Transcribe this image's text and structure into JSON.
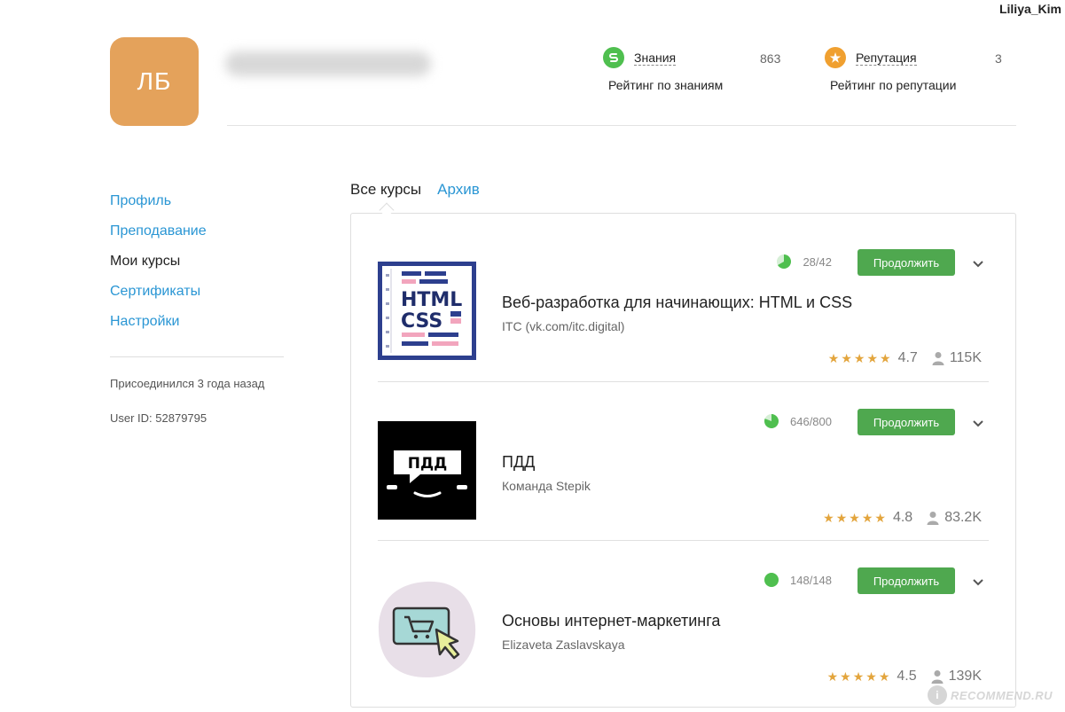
{
  "top_user": "Liliya_Kim",
  "profile": {
    "avatar_initials": "ЛБ",
    "avatar_color": "#e4a25b"
  },
  "stats": {
    "knowledge": {
      "label": "Знания",
      "value": "863",
      "sub": "Рейтинг по знаниям",
      "icon": "knowledge-icon",
      "color": "#4fbf4f"
    },
    "reputation": {
      "label": "Репутация",
      "value": "3",
      "sub": "Рейтинг по репутации",
      "icon": "star-icon",
      "color": "#f0a030"
    }
  },
  "sidebar": {
    "items": [
      {
        "label": "Профиль",
        "active": false
      },
      {
        "label": "Преподавание",
        "active": false
      },
      {
        "label": "Мои курсы",
        "active": true
      },
      {
        "label": "Сертификаты",
        "active": false
      },
      {
        "label": "Настройки",
        "active": false
      }
    ],
    "joined": "Присоединился 3 года назад",
    "user_id": "User ID: 52879795"
  },
  "tabs": [
    {
      "label": "Все курсы",
      "active": true
    },
    {
      "label": "Архив",
      "active": false
    }
  ],
  "courses": [
    {
      "title": "Веб-разработка для начинающих: HTML и CSS",
      "author": "ITC (vk.com/itc.digital)",
      "progress_text": "28/42",
      "progress": 0.667,
      "button": "Продолжить",
      "stars": "★★★★★",
      "rating": "4.7",
      "learners": "115K",
      "cover_text_1": "HTML",
      "cover_text_2": "CSS"
    },
    {
      "title": "ПДД",
      "author": "Команда Stepik",
      "progress_text": "646/800",
      "progress": 0.8075,
      "button": "Продолжить",
      "stars": "★★★★★",
      "rating": "4.8",
      "learners": "83.2K",
      "cover_text_1": "ПДД"
    },
    {
      "title": "Основы интернет-маркетинга",
      "author": "Elizaveta Zaslavskaya",
      "progress_text": "148/148",
      "progress": 1.0,
      "button": "Продолжить",
      "stars": "★★★★★",
      "rating": "4.5",
      "learners": "139K"
    }
  ],
  "watermark": {
    "badge": "i",
    "text": "RECOMMEND.RU"
  }
}
